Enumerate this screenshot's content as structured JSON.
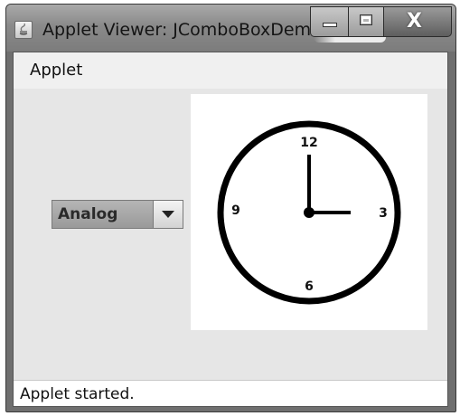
{
  "window": {
    "title": "Applet Viewer: JComboBoxDemo",
    "controls": [
      "minimize-icon",
      "maximize-icon",
      "close-icon"
    ]
  },
  "menubar": {
    "menu_label": "Applet"
  },
  "combo": {
    "selected": "Analog"
  },
  "clock": {
    "labels": {
      "twelve": "12",
      "three": "3",
      "six": "6",
      "nine": "9"
    },
    "time": {
      "hour": 3,
      "minute": 0
    }
  },
  "status": {
    "text": "Applet started."
  },
  "colors": {
    "clock_face": "#ffffff",
    "clock_ink": "#000000",
    "panel_bg": "#e6e6e6"
  }
}
